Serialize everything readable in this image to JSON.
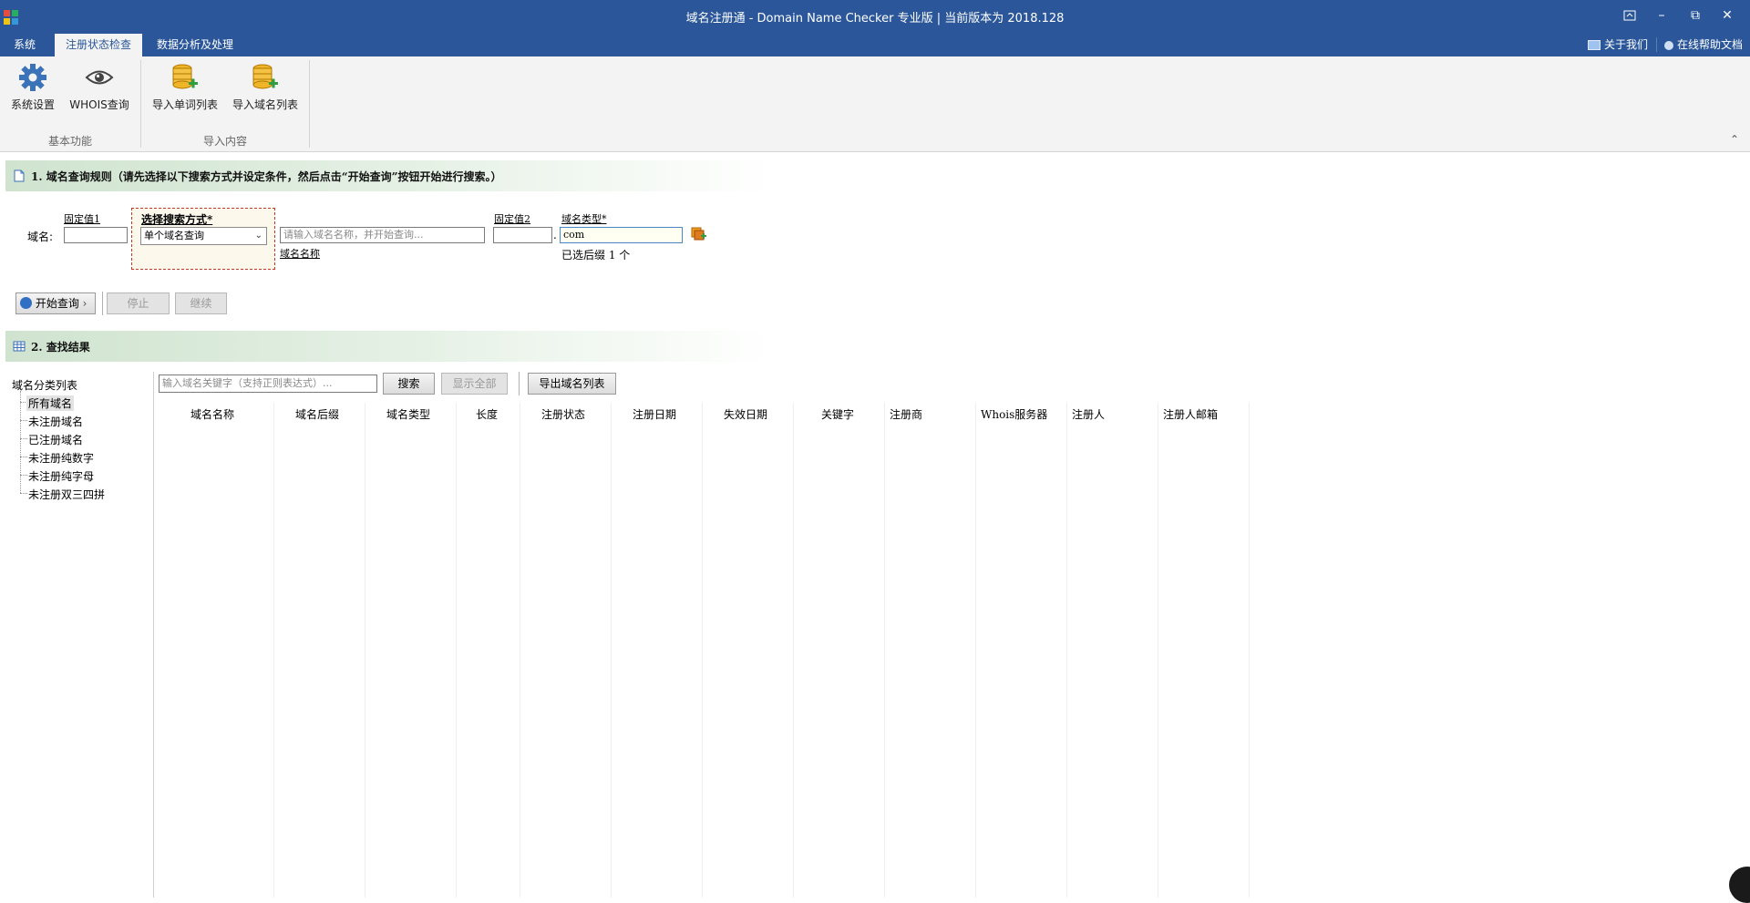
{
  "window": {
    "title": "域名注册通 - Domain Name Checker 专业版 | 当前版本为 2018.128",
    "buttons": [
      "restore-special",
      "minimize",
      "maximize",
      "close"
    ]
  },
  "menu": {
    "tabs": [
      "系统",
      "注册状态检查",
      "数据分析及处理"
    ],
    "active_tab": "注册状态检查",
    "help_links": [
      "关于我们",
      "在线帮助文档"
    ]
  },
  "ribbon": {
    "groups": [
      {
        "name": "基本功能",
        "buttons": [
          {
            "label": "系统设置",
            "icon": "gear-icon"
          },
          {
            "label": "WHOIS查询",
            "icon": "eye-icon"
          }
        ]
      },
      {
        "name": "导入内容",
        "buttons": [
          {
            "label": "导入单词列表",
            "icon": "database-add-icon"
          },
          {
            "label": "导入域名列表",
            "icon": "database-add-icon"
          }
        ]
      }
    ]
  },
  "section1": {
    "header": "1. 域名查询规则（请先选择以下搜索方式并设定条件，然后点击“开始查询”按钮开始进行搜索。）",
    "domain_label": "域名:",
    "fixed1_label": "固定值1",
    "fixed1_value": "",
    "search_mode_label": "选择搜索方式*",
    "search_mode_value": "单个域名查询",
    "domain_name_placeholder": "请输入域名名称，并开始查询...",
    "domain_name_label": "域名名称",
    "fixed2_label": "固定值2",
    "fixed2_value": "",
    "dot": ".",
    "domain_type_label": "域名类型*",
    "domain_type_value": "com",
    "selected_suffix_text": "已选后缀 1 个",
    "buttons": {
      "start": "开始查询",
      "stop": "停止",
      "continue": "继续"
    }
  },
  "section2": {
    "header": "2. 查找结果",
    "tree": {
      "root": "域名分类列表",
      "items": [
        "所有域名",
        "未注册域名",
        "已注册域名",
        "未注册纯数字",
        "未注册纯字母",
        "未注册双三四拼"
      ],
      "selected": "所有域名"
    },
    "search_placeholder": "输入域名关键字（支持正则表达式）...",
    "buttons": {
      "search": "搜索",
      "show_all": "显示全部",
      "export": "导出域名列表"
    },
    "columns": [
      "域名名称",
      "域名后缀",
      "域名类型",
      "长度",
      "注册状态",
      "注册日期",
      "失效日期",
      "关键字",
      "注册商",
      "Whois服务器",
      "注册人",
      "注册人邮箱"
    ]
  },
  "colors": {
    "titlebar": "#2b579a",
    "ribbon": "#f3f3f3",
    "section_header": "#cfe3cf",
    "dashed_border": "#c0392b"
  }
}
